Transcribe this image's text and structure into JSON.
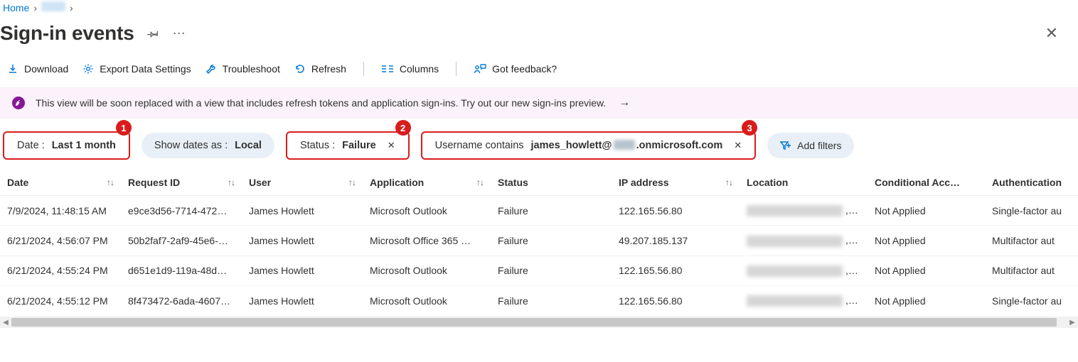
{
  "breadcrumb": {
    "home": "Home",
    "sep": "›"
  },
  "page": {
    "title": "Sign-in events"
  },
  "toolbar": {
    "download": "Download",
    "export": "Export Data Settings",
    "troubleshoot": "Troubleshoot",
    "refresh": "Refresh",
    "columns": "Columns",
    "feedback": "Got feedback?"
  },
  "banner": {
    "text": "This view will be soon replaced with a view that includes refresh tokens and application sign-ins. Try out our new sign-ins preview."
  },
  "filters": {
    "date_label": "Date : ",
    "date_value": "Last 1 month",
    "date_badge": "1",
    "showdates_label": "Show dates as : ",
    "showdates_value": "Local",
    "status_label": "Status : ",
    "status_value": "Failure",
    "status_badge": "2",
    "user_label": "Username contains ",
    "user_value_prefix": "james_howlett@",
    "user_value_suffix": ".onmicrosoft.com",
    "user_badge": "3",
    "add": "Add filters"
  },
  "columns": {
    "date": "Date",
    "request_id": "Request ID",
    "user": "User",
    "application": "Application",
    "status": "Status",
    "ip": "IP address",
    "location": "Location",
    "conditional": "Conditional Acc…",
    "auth": "Authentication"
  },
  "rows": [
    {
      "date": "7/9/2024, 11:48:15 AM",
      "request_id": "e9ce3d56-7714-472…",
      "user": "James Howlett",
      "application": "Microsoft Outlook",
      "status": "Failure",
      "ip": "122.165.56.80",
      "location_ellipsis": ",…",
      "conditional": "Not Applied",
      "auth": "Single-factor au"
    },
    {
      "date": "6/21/2024, 4:56:07 PM",
      "request_id": "50b2faf7-2af9-45e6-…",
      "user": "James Howlett",
      "application": "Microsoft Office 365 …",
      "status": "Failure",
      "ip": "49.207.185.137",
      "location_ellipsis": ",…",
      "conditional": "Not Applied",
      "auth": "Multifactor aut"
    },
    {
      "date": "6/21/2024, 4:55:24 PM",
      "request_id": "d651e1d9-119a-48d…",
      "user": "James Howlett",
      "application": "Microsoft Outlook",
      "status": "Failure",
      "ip": "122.165.56.80",
      "location_ellipsis": ",…",
      "conditional": "Not Applied",
      "auth": "Multifactor aut"
    },
    {
      "date": "6/21/2024, 4:55:12 PM",
      "request_id": "8f473472-6ada-4607…",
      "user": "James Howlett",
      "application": "Microsoft Outlook",
      "status": "Failure",
      "ip": "122.165.56.80",
      "location_ellipsis": ",…",
      "conditional": "Not Applied",
      "auth": "Single-factor au"
    }
  ]
}
